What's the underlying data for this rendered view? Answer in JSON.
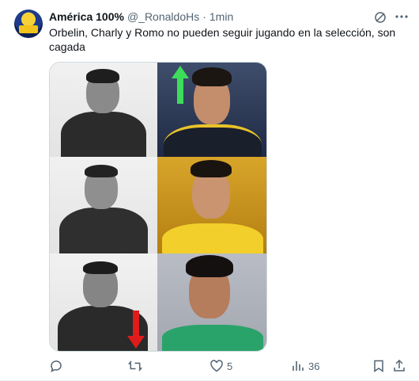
{
  "tweet": {
    "display_name": "América 100%",
    "handle": "@_RonaldoHs",
    "separator": "·",
    "time": "1min",
    "text": "Orbelin, Charly y Romo no pueden seguir jugando en la selección, son cagada"
  },
  "media": {
    "description_icons": [
      "green-up-arrow",
      "red-down-arrow"
    ]
  },
  "actions": {
    "reply_count": "",
    "retweet_count": "",
    "like_count": "5",
    "view_count": "36"
  },
  "colors": {
    "text": "#0f1419",
    "secondary": "#536471",
    "up_arrow": "#3ddc5a",
    "down_arrow": "#e01b1b"
  }
}
